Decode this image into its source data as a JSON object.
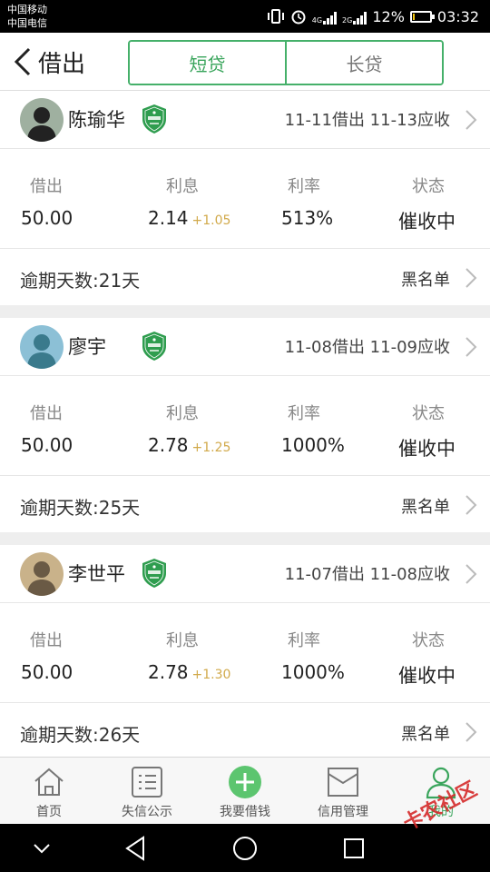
{
  "status": {
    "carrier1": "中国移动",
    "carrier2": "中国电信",
    "net1": "4G",
    "net2": "2G",
    "battery_percent_text": "12%",
    "battery_level": 0.12,
    "time": "03:32"
  },
  "header": {
    "title": "借出",
    "tabs": [
      "短贷",
      "长贷"
    ],
    "active_tab": 0
  },
  "labels": {
    "lent": "借出",
    "interest": "利息",
    "rate": "利率",
    "status": "状态",
    "blacklist": "黑名单"
  },
  "loans": [
    {
      "name": "陈瑜华",
      "dates": "11-11借出 11-13应收",
      "amount": "50.00",
      "interest": "2.14",
      "interest_extra": "+1.05",
      "rate": "513%",
      "status": "催收中",
      "overdue": "逾期天数:21天"
    },
    {
      "name": "廖宇",
      "dates": "11-08借出 11-09应收",
      "amount": "50.00",
      "interest": "2.78",
      "interest_extra": "+1.25",
      "rate": "1000%",
      "status": "催收中",
      "overdue": "逾期天数:25天"
    },
    {
      "name": "李世平",
      "dates": "11-07借出 11-08应收",
      "amount": "50.00",
      "interest": "2.78",
      "interest_extra": "+1.30",
      "rate": "1000%",
      "status": "催收中",
      "overdue": "逾期天数:26天"
    }
  ],
  "tabbar": {
    "items": [
      {
        "label": "首页",
        "icon": "home-icon"
      },
      {
        "label": "失信公示",
        "icon": "list-icon"
      },
      {
        "label": "我要借钱",
        "icon": "plus-circle-icon"
      },
      {
        "label": "信用管理",
        "icon": "inbox-icon"
      },
      {
        "label": "我的",
        "icon": "user-icon"
      }
    ],
    "active": 4
  },
  "watermark": "卡农社区",
  "colors": {
    "accent": "#3aa55c",
    "interest_extra": "#d1a94a"
  }
}
